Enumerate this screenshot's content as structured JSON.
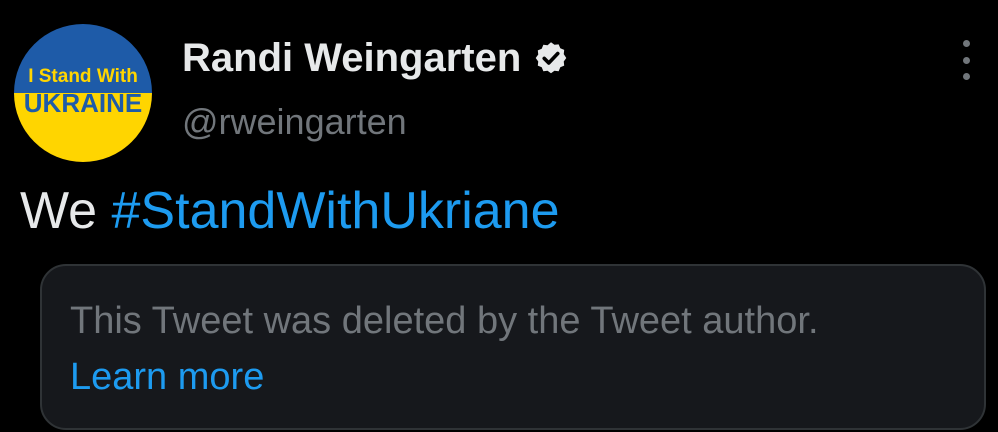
{
  "tweet": {
    "avatar": {
      "line1": "I Stand With",
      "line2": "UKRAINE",
      "top_color": "#1e5ba8",
      "bottom_color": "#ffd500"
    },
    "author_name": "Randi Weingarten",
    "handle": "@rweingarten",
    "verified_icon": "verified-badge-icon",
    "text_prefix": "We",
    "hashtag": "#StandWithUkriane",
    "more_icon": "more-vertical-icon"
  },
  "deleted_quote": {
    "message": "This Tweet was deleted by the Tweet author.",
    "learn_more_label": "Learn more"
  },
  "colors": {
    "background": "#000000",
    "primary_text": "#e7e9ea",
    "secondary_text": "#71767b",
    "accent": "#1d9bf0",
    "card_background": "#16181c",
    "card_border": "#2f3336"
  }
}
